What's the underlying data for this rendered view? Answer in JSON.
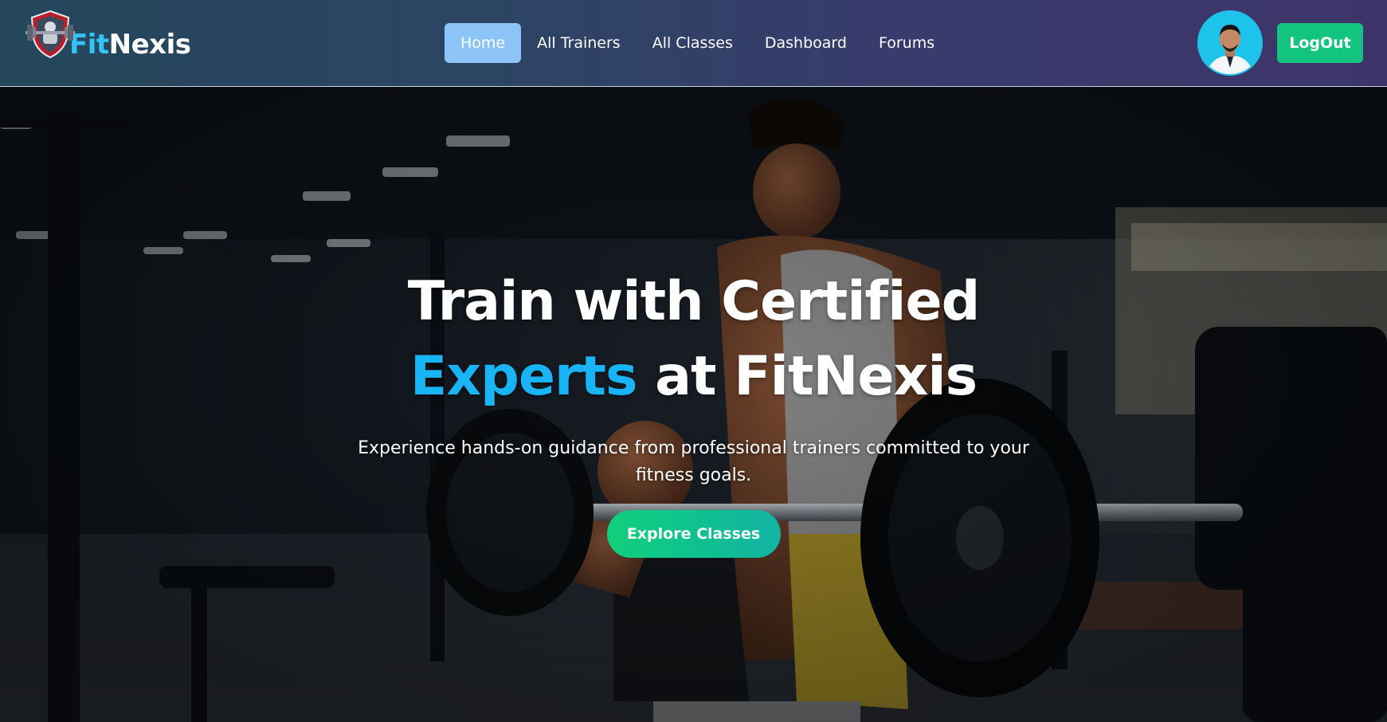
{
  "brand": {
    "logo_icon": "dumbbell-shield-logo",
    "name_part1": "Fit",
    "name_part2": "Nexis"
  },
  "nav": {
    "links": [
      {
        "label": "Home",
        "active": true
      },
      {
        "label": "All Trainers",
        "active": false
      },
      {
        "label": "All Classes",
        "active": false
      },
      {
        "label": "Dashboard",
        "active": false
      },
      {
        "label": "Forums",
        "active": false
      }
    ],
    "avatar_icon": "user-avatar",
    "logout_label": "LogOut"
  },
  "hero": {
    "title_line1": "Train with Certified",
    "title_accent": "Experts",
    "title_line2_rest": " at FitNexis",
    "subtitle": "Experience hands-on guidance from professional trainers committed to your fitness goals.",
    "cta_label": "Explore Classes",
    "background_image": "gym-trainer-spotting-barbell-squat-photo"
  },
  "colors": {
    "accent_blue": "#19b4f5",
    "brand_blue": "#33c4f6",
    "active_nav": "#8cc4f7",
    "green_button": "#12c47e"
  }
}
